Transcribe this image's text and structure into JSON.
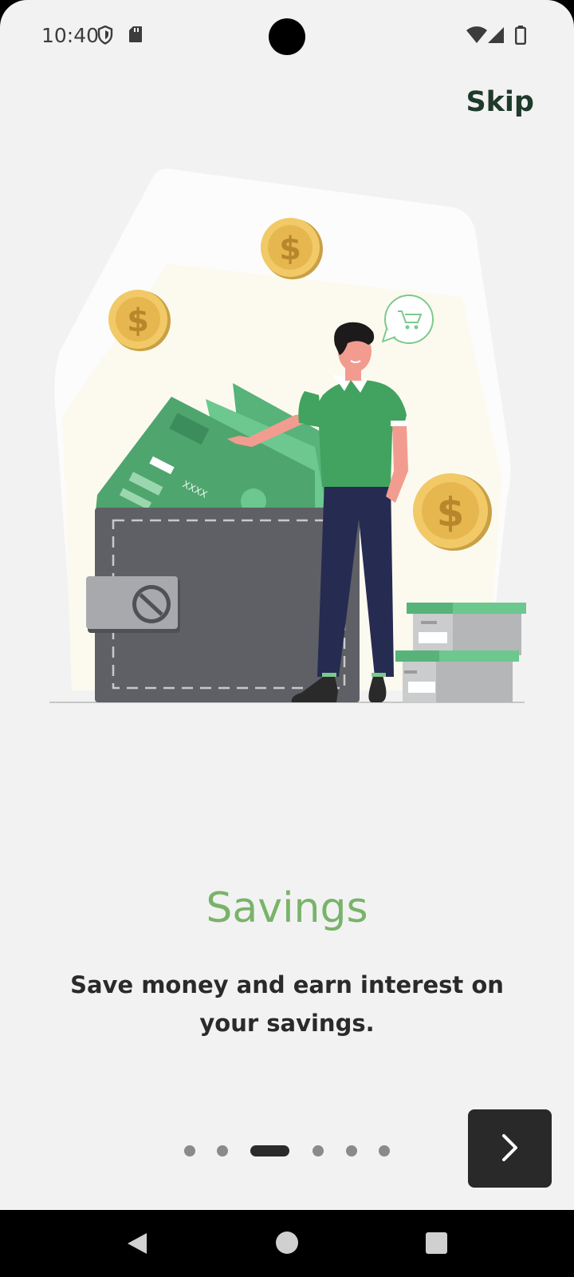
{
  "status_bar": {
    "time": "10:40",
    "icons": [
      "shield-icon",
      "sd-card-icon",
      "wifi-icon",
      "signal-icon",
      "battery-icon"
    ]
  },
  "header": {
    "skip_label": "Skip"
  },
  "illustration": {
    "name": "savings-illustration",
    "card_text": "XXXX",
    "coin_symbol": "$"
  },
  "content": {
    "title": "Savings",
    "description": "Save money and earn interest on your savings."
  },
  "pager": {
    "total": 6,
    "active_index": 2
  },
  "next_button": {
    "icon": "chevron-right-icon"
  },
  "nav_bar": {
    "buttons": [
      "back-icon",
      "home-icon",
      "recents-icon"
    ]
  },
  "colors": {
    "title": "#79b36a",
    "accent_green": "#66c089",
    "button_dark": "#292929",
    "background": "#f2f2f2"
  }
}
